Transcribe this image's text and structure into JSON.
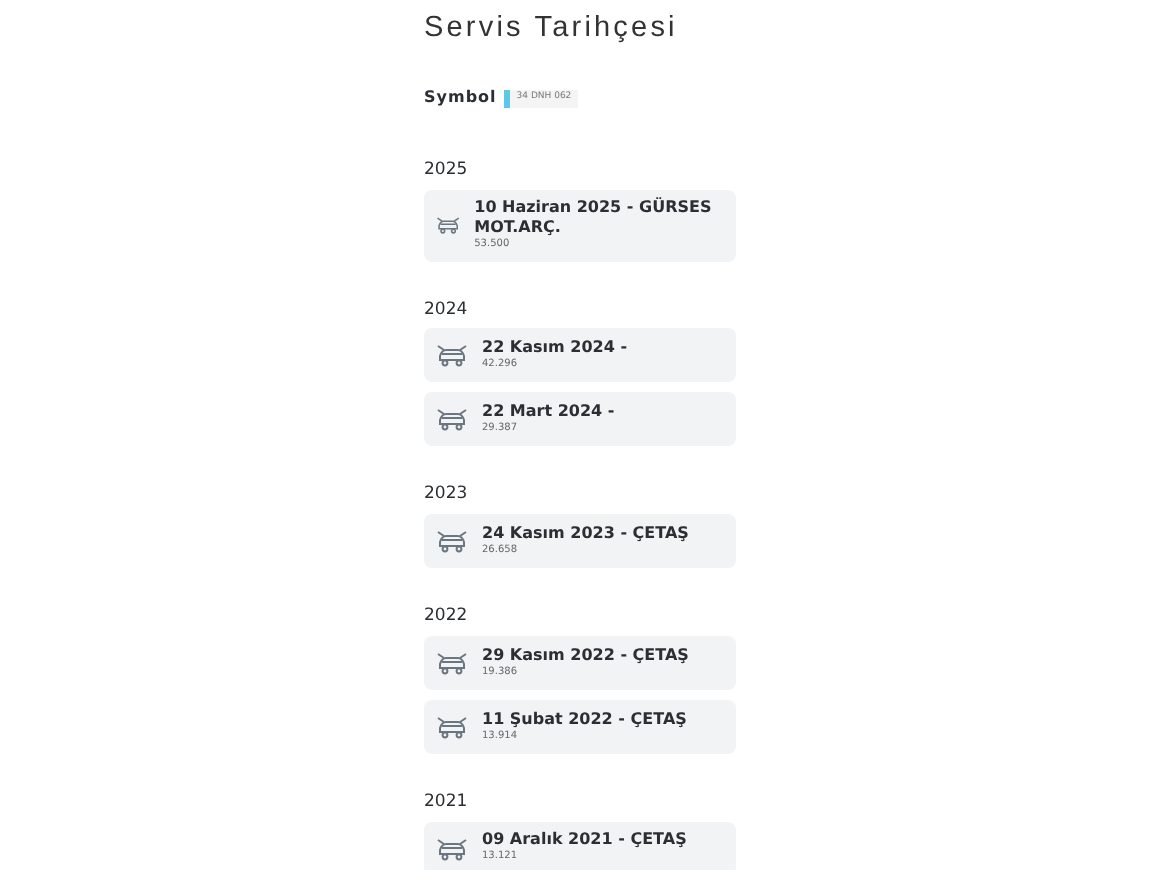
{
  "title": "Servis Tarihçesi",
  "vehicle": {
    "label": "Symbol",
    "plate": "34 DNH 062"
  },
  "years": [
    {
      "year": "2025",
      "records": [
        {
          "title": "10 Haziran 2025 - GÜRSES MOT.ARÇ.",
          "mileage": "53.500"
        }
      ]
    },
    {
      "year": "2024",
      "records": [
        {
          "title": "22 Kasım 2024 -",
          "mileage": "42.296"
        },
        {
          "title": "22 Mart 2024 -",
          "mileage": "29.387"
        }
      ]
    },
    {
      "year": "2023",
      "records": [
        {
          "title": "24 Kasım 2023 - ÇETAŞ",
          "mileage": "26.658"
        }
      ]
    },
    {
      "year": "2022",
      "records": [
        {
          "title": "29 Kasım 2022 - ÇETAŞ",
          "mileage": "19.386"
        },
        {
          "title": "11 Şubat 2022 - ÇETAŞ",
          "mileage": "13.914"
        }
      ]
    },
    {
      "year": "2021",
      "records": [
        {
          "title": "09 Aralık 2021 - ÇETAŞ",
          "mileage": "13.121"
        }
      ]
    }
  ]
}
